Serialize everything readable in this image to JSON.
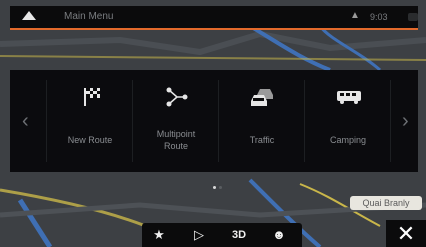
{
  "header": {
    "title": "Main Menu",
    "time": "9:03"
  },
  "menu": {
    "items": [
      {
        "label": "New Route",
        "icon": "checkered-flag-icon"
      },
      {
        "label_line1": "Multipoint",
        "label_line2": "Route",
        "icon": "multipoint-route-icon"
      },
      {
        "label": "Traffic",
        "icon": "traffic-cars-icon"
      },
      {
        "label": "Camping",
        "icon": "camping-vehicle-icon"
      }
    ],
    "pages": 2,
    "active_page": 1
  },
  "toolbar": {
    "favorites_icon": "star-icon",
    "sound_icon": "speaker-icon",
    "view_label": "3D",
    "profile_icon": "person-icon"
  },
  "map": {
    "street_label": "Quai Branly"
  },
  "colors": {
    "accent": "#e36a2c",
    "panel": "#08080a",
    "map_base": "#3a3d40",
    "road_blue": "#3f6fb4",
    "road_yellow": "#c9b64a"
  }
}
